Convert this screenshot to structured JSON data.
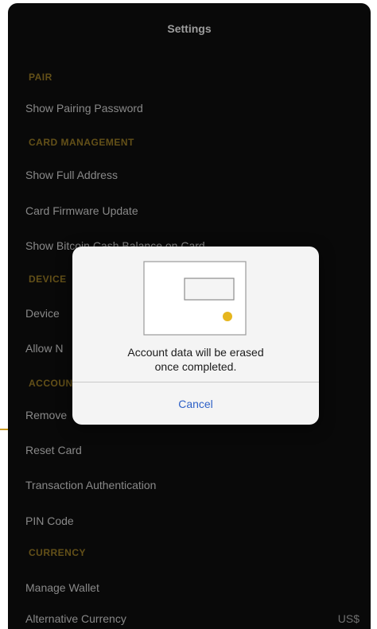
{
  "header": {
    "title": "Settings"
  },
  "sections": {
    "pair": "PAIR",
    "card_management": "CARD MANAGEMENT",
    "device": "DEVICE",
    "account": "ACCOUNT",
    "currency": "CURRENCY"
  },
  "rows": {
    "show_pairing_password": "Show Pairing Password",
    "show_full_address": "Show Full Address",
    "card_firmware_update": "Card Firmware Update",
    "show_bitcoin_cash": "Show Bitcoin Cash Balance on Card",
    "device_row": "Device",
    "allow_row": "Allow N",
    "remove_row": "Remove",
    "reset_card": "Reset Card",
    "transaction_authentication": "Transaction Authentication",
    "pin_code": "PIN Code",
    "manage_wallet": "Manage Wallet",
    "alternative_currency": "Alternative Currency",
    "alternative_currency_value": "US$"
  },
  "modal": {
    "message_line1": "Account data will be erased",
    "message_line2": "once completed.",
    "cancel_label": "Cancel",
    "icon": "card-illustration-icon"
  },
  "colors": {
    "background": "#0d0d0d",
    "section_header": "#8a6f22",
    "accent_gold": "#c99a25",
    "link_blue": "#2f62c7"
  }
}
